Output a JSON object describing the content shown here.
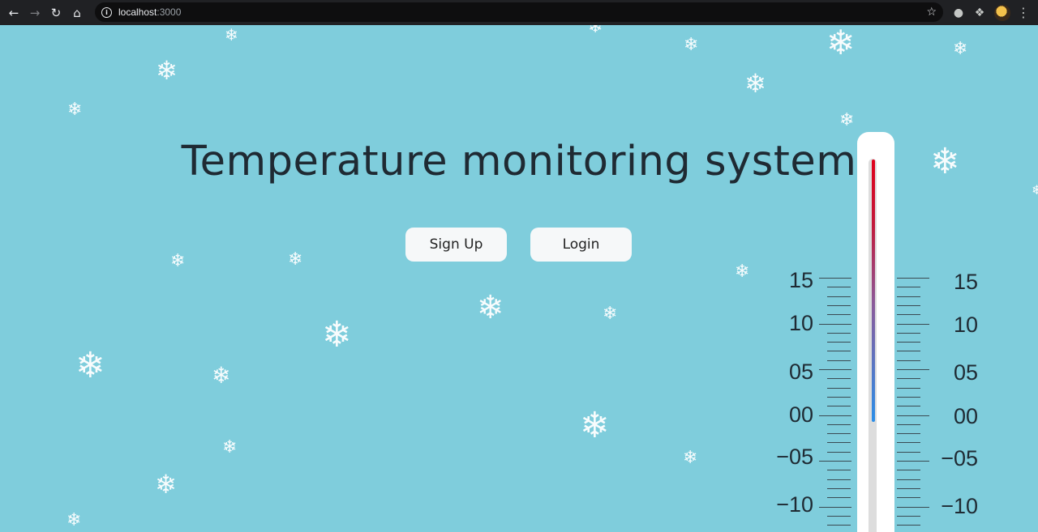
{
  "browser": {
    "url_host": "localhost",
    "url_port": ":3000",
    "icons": [
      "back-icon",
      "forward-icon",
      "reload-icon",
      "home-icon",
      "info-icon",
      "star-icon",
      "globe-icon",
      "extensions-icon",
      "avatar",
      "menu-icon"
    ]
  },
  "page": {
    "title": "Temperature monitoring system",
    "signup_label": "Sign Up",
    "login_label": "Login",
    "snowflake_glyph": "❄",
    "accent_colors": {
      "background": "#7fcddc",
      "mercury_top": "#e0001a",
      "mercury_bottom": "#2b8ee8"
    }
  },
  "thermometer": {
    "left_labels": [
      "15",
      "10",
      "05",
      "00",
      "−05",
      "−10"
    ],
    "right_labels": [
      "15",
      "10",
      "05",
      "00",
      "−05",
      "−10"
    ]
  }
}
